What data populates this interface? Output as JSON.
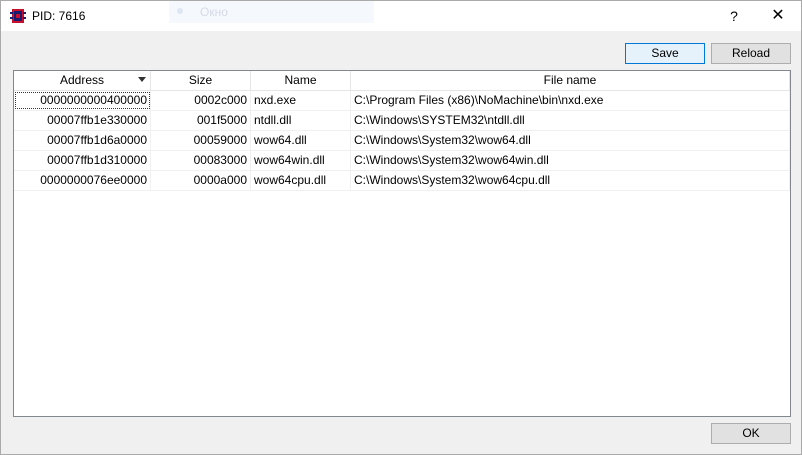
{
  "window": {
    "title": "PID: 7616",
    "background_hint": "Окно",
    "help_glyph": "?",
    "close_glyph": "✕"
  },
  "toolbar": {
    "save_label": "Save",
    "reload_label": "Reload"
  },
  "table": {
    "columns": [
      "Address",
      "Size",
      "Name",
      "File name"
    ],
    "sort_column": "Address",
    "rows": [
      {
        "address": "0000000000400000",
        "size": "0002c000",
        "name": "nxd.exe",
        "file": "C:\\Program Files (x86)\\NoMachine\\bin\\nxd.exe"
      },
      {
        "address": "00007ffb1e330000",
        "size": "001f5000",
        "name": "ntdll.dll",
        "file": "C:\\Windows\\SYSTEM32\\ntdll.dll"
      },
      {
        "address": "00007ffb1d6a0000",
        "size": "00059000",
        "name": "wow64.dll",
        "file": "C:\\Windows\\System32\\wow64.dll"
      },
      {
        "address": "00007ffb1d310000",
        "size": "00083000",
        "name": "wow64win.dll",
        "file": "C:\\Windows\\System32\\wow64win.dll"
      },
      {
        "address": "0000000076ee0000",
        "size": "0000a000",
        "name": "wow64cpu.dll",
        "file": "C:\\Windows\\System32\\wow64cpu.dll"
      }
    ]
  },
  "footer": {
    "ok_label": "OK"
  },
  "colors": {
    "accent_border": "#0078d7",
    "button_face": "#e1e1e1"
  },
  "icons": {
    "app": "process-icon",
    "sort": "sort-descending-icon"
  }
}
